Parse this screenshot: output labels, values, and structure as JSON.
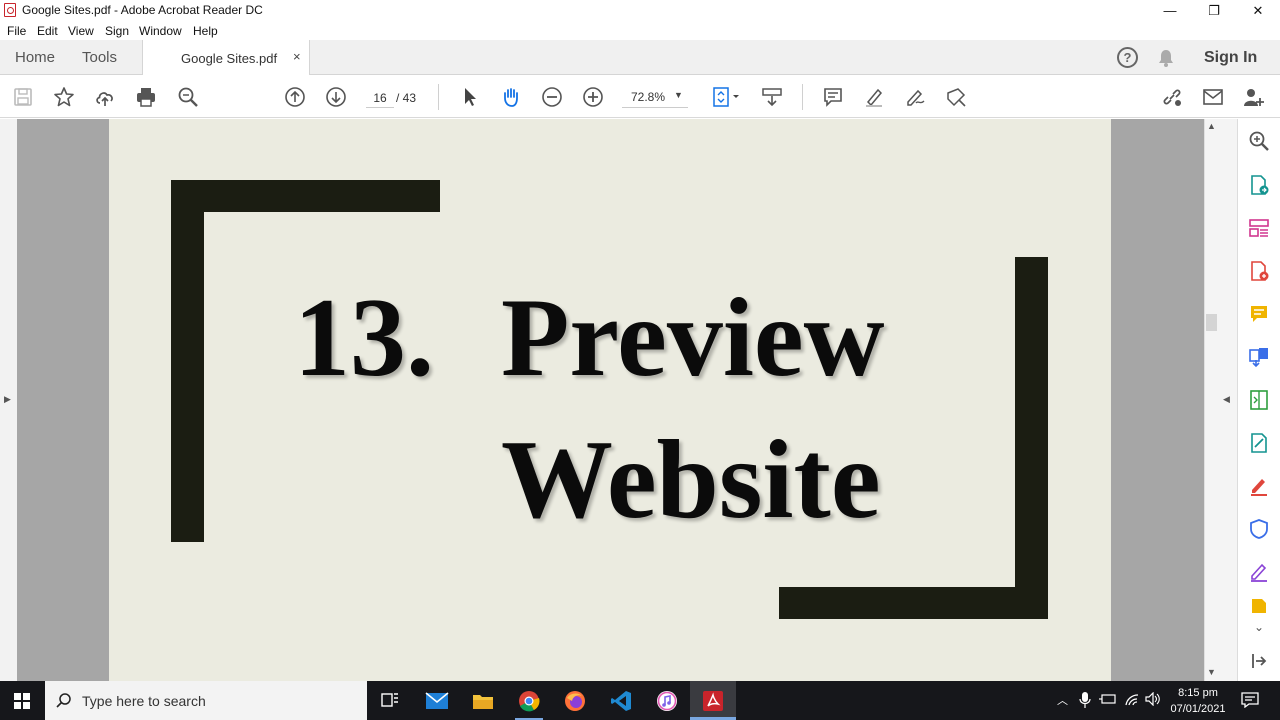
{
  "window": {
    "title": "Google Sites.pdf - Adobe Acrobat Reader DC",
    "min": "—",
    "restore": "❐",
    "close": "✕"
  },
  "menu": [
    "File",
    "Edit",
    "View",
    "Sign",
    "Window",
    "Help"
  ],
  "tabs": {
    "home": "Home",
    "tools": "Tools",
    "document": "Google Sites.pdf",
    "close": "×"
  },
  "header": {
    "help": "?",
    "sign_in": "Sign In"
  },
  "toolbar": {
    "page_current": "16",
    "page_total": "/  43",
    "zoom": "72.8%",
    "zoom_caret": "▼"
  },
  "document": {
    "number": "13.",
    "title_line1": "Preview",
    "title_line2": "Website"
  },
  "taskbar": {
    "search_placeholder": "Type here to search",
    "time": "8:15 pm",
    "date": "07/01/2021"
  },
  "colors": {
    "accent_blue": "#1473e6",
    "pdf_red": "#c8242b",
    "page_bg": "#ebebe0",
    "bracket": "#1b1d12"
  }
}
